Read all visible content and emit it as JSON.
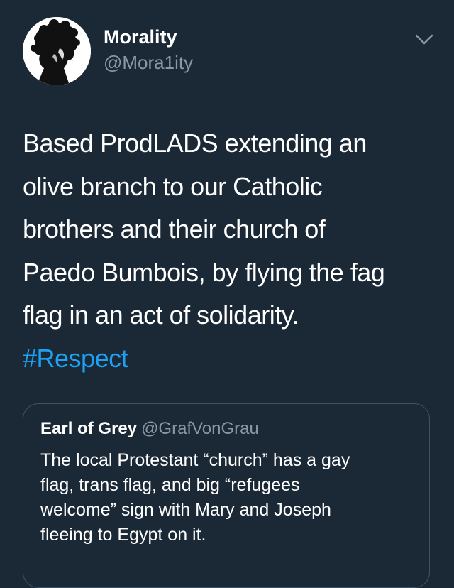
{
  "author": {
    "display_name": "Morality",
    "handle": "@Mora1ity",
    "avatar_icon": "profile-avatar"
  },
  "menu_icon": "chevron-down-icon",
  "tweet": {
    "lines": [
      "Based ProdLADS extending an",
      "olive branch to our Catholic",
      "brothers and their church of",
      "Paedo Bumbois, by flying the fag",
      "flag in an act of solidarity."
    ],
    "hashtag": "#Respect"
  },
  "quoted_tweet": {
    "display_name": "Earl of Grey",
    "handle": "@GrafVonGrau",
    "lines": [
      "The local Protestant “church” has a gay",
      "flag, trans flag, and big “refugees",
      "welcome” sign with Mary and Joseph",
      "fleeing to Egypt on it."
    ]
  },
  "colors": {
    "background": "#1b2836",
    "text": "#ffffff",
    "secondary": "#8899a6",
    "link": "#1da1f2",
    "border": "#3d5466"
  }
}
